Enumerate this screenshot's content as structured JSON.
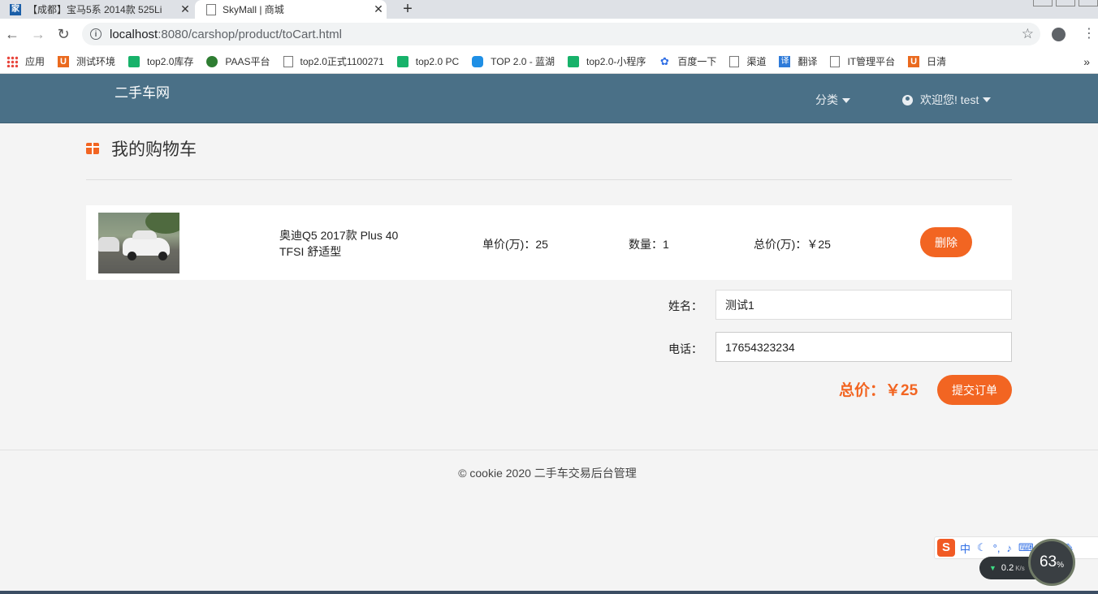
{
  "browser": {
    "tabs": [
      {
        "title": "【成都】宝马5系 2014款 525Li",
        "icon": "home-favicon"
      },
      {
        "title": "SkyMall | 商城",
        "icon": "page-favicon"
      }
    ],
    "url_host": "localhost",
    "url_rest": ":8080/carshop/product/toCart.html",
    "bookmarks": [
      {
        "label": "应用",
        "icon": "apps-icon"
      },
      {
        "label": "测试环境",
        "icon": "u-icon"
      },
      {
        "label": "top2.0库存",
        "icon": "play-icon"
      },
      {
        "label": "PAAS平台",
        "icon": "globe-icon"
      },
      {
        "label": "top2.0正式1100271",
        "icon": "doc-icon"
      },
      {
        "label": "top2.0 PC",
        "icon": "play-icon"
      },
      {
        "label": "TOP 2.0 - 蓝湖",
        "icon": "fish-icon"
      },
      {
        "label": "top2.0-小程序",
        "icon": "play-icon"
      },
      {
        "label": "百度一下",
        "icon": "paw-icon"
      },
      {
        "label": "渠道",
        "icon": "doc-icon"
      },
      {
        "label": "翻译",
        "icon": "translate-icon"
      },
      {
        "label": "IT管理平台",
        "icon": "doc-icon"
      },
      {
        "label": "日清",
        "icon": "u-icon"
      }
    ]
  },
  "site": {
    "brand": "二手车网",
    "nav_category": "分类",
    "nav_user": "欢迎您! test"
  },
  "page": {
    "title": "我的购物车"
  },
  "cart": {
    "items": [
      {
        "name": "奥迪Q5 2017款 Plus 40 TFSI 舒适型",
        "unit_price": "单价(万)：25",
        "quantity": "数量：1",
        "total": "总价(万)：￥25",
        "delete_label": "删除"
      }
    ]
  },
  "form": {
    "name_label": "姓名：",
    "name_value": "测试1",
    "phone_label": "电话：",
    "phone_value": "17654323234"
  },
  "summary": {
    "total": "总价：￥25",
    "submit_label": "提交订单"
  },
  "footer": {
    "text": "© cookie 2020   二手车交易后台管理"
  },
  "system": {
    "ime_lang": "中",
    "net_speed": "0.2",
    "net_unit": "K/s",
    "cpu_value": "63",
    "cpu_unit": "%"
  },
  "colors": {
    "header": "#4a7087",
    "accent": "#f26522",
    "background": "#f4f4f4"
  }
}
